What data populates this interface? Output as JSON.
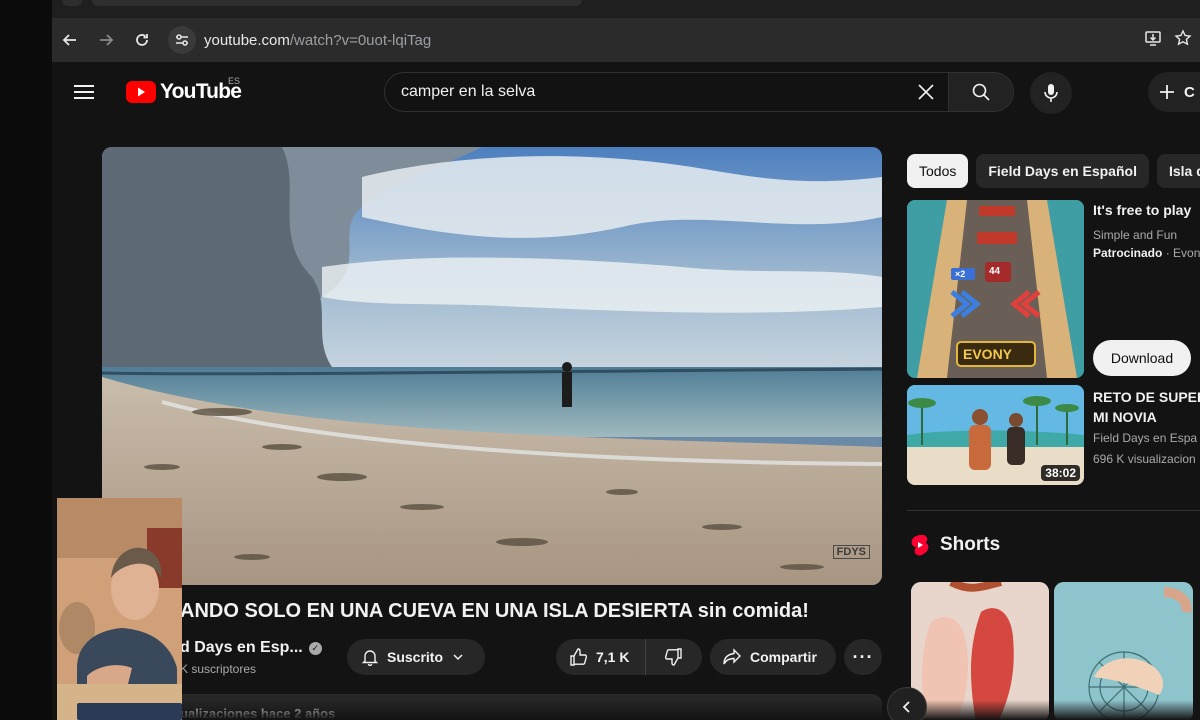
{
  "browser": {
    "url_domain": "youtube.com",
    "url_path": "/watch?v=0uot-lqiTag",
    "back_icon": "arrow-left-icon",
    "forward_icon": "arrow-right-icon",
    "reload_icon": "reload-icon"
  },
  "header": {
    "logo_text": "YouTube",
    "country_code": "ES",
    "search_value": "camper en la selva",
    "create_label": "C"
  },
  "video": {
    "title": "ANDO SOLO EN UNA CUEVA EN UNA ISLA DESIERTA sin comida!",
    "channel": "d Days en Esp...",
    "subscribers": "K suscriptores",
    "subscribe_label": "Suscrito",
    "likes": "7,1 K",
    "share_label": "Compartir",
    "more_label": "···",
    "description_preview": "ualizaciones  hace 2 años",
    "watermark": "FDYS"
  },
  "sidebar": {
    "chips": [
      {
        "label": "Todos",
        "active": true
      },
      {
        "label": "Field Days en Español",
        "active": false
      },
      {
        "label": "Isla d",
        "active": false
      }
    ],
    "ad": {
      "title": "It's free to play",
      "subtitle": "Simple and Fun",
      "sponsor_label": "Patrocinado",
      "sponsor_sep": " · ",
      "advertiser": "Evon",
      "button": "Download",
      "thumb_text": "EVONY",
      "thumb_badge_1": "44",
      "thumb_badge_2": "×2"
    },
    "recommendation": {
      "title_line1": "RETO DE SUPER",
      "title_line2": "MI NOVIA",
      "channel": "Field Days en Espa",
      "views": "696 K visualizacion",
      "duration": "38:02"
    },
    "shorts_label": "Shorts"
  },
  "colors": {
    "yt_red": "#ff0000",
    "page_bg": "#131313",
    "pill_bg": "#272727"
  }
}
